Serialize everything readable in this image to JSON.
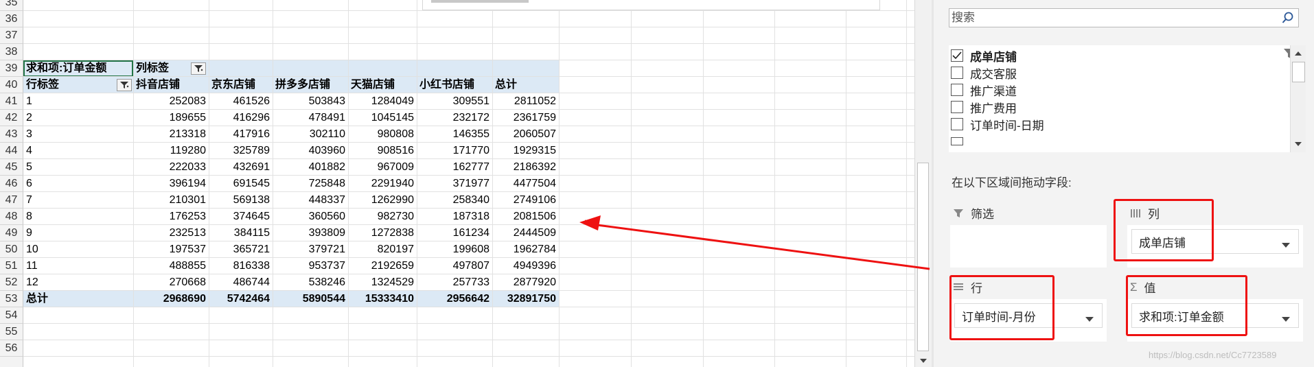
{
  "sheet": {
    "empty_rows": [
      "35",
      "36",
      "37",
      "38",
      "54",
      "55",
      "56"
    ],
    "pivot": {
      "value_title": "求和项:订单金额",
      "column_label": "列标签",
      "row_label": "行标签",
      "columns": [
        "抖音店铺",
        "京东店铺",
        "拼多多店铺",
        "天猫店铺",
        "小红书店铺",
        "总计"
      ],
      "rows": [
        {
          "rownum": "41",
          "label": "1",
          "values": [
            "252083",
            "461526",
            "503843",
            "1284049",
            "309551",
            "2811052"
          ]
        },
        {
          "rownum": "42",
          "label": "2",
          "values": [
            "189655",
            "416296",
            "478491",
            "1045145",
            "232172",
            "2361759"
          ]
        },
        {
          "rownum": "43",
          "label": "3",
          "values": [
            "213318",
            "417916",
            "302110",
            "980808",
            "146355",
            "2060507"
          ]
        },
        {
          "rownum": "44",
          "label": "4",
          "values": [
            "119280",
            "325789",
            "403960",
            "908516",
            "171770",
            "1929315"
          ]
        },
        {
          "rownum": "45",
          "label": "5",
          "values": [
            "222033",
            "432691",
            "401882",
            "967009",
            "162777",
            "2186392"
          ]
        },
        {
          "rownum": "46",
          "label": "6",
          "values": [
            "396194",
            "691545",
            "725848",
            "2291940",
            "371977",
            "4477504"
          ]
        },
        {
          "rownum": "47",
          "label": "7",
          "values": [
            "210301",
            "569138",
            "448337",
            "1262990",
            "258340",
            "2749106"
          ]
        },
        {
          "rownum": "48",
          "label": "8",
          "values": [
            "176253",
            "374645",
            "360560",
            "982730",
            "187318",
            "2081506"
          ]
        },
        {
          "rownum": "49",
          "label": "9",
          "values": [
            "232513",
            "384115",
            "393809",
            "1272838",
            "161234",
            "2444509"
          ]
        },
        {
          "rownum": "50",
          "label": "10",
          "values": [
            "197537",
            "365721",
            "379721",
            "820197",
            "199608",
            "1962784"
          ]
        },
        {
          "rownum": "51",
          "label": "11",
          "values": [
            "488855",
            "816338",
            "953737",
            "2192659",
            "497807",
            "4949396"
          ]
        },
        {
          "rownum": "52",
          "label": "12",
          "values": [
            "270668",
            "486744",
            "538246",
            "1324529",
            "257733",
            "2877920"
          ]
        }
      ],
      "total": {
        "rownum": "53",
        "label": "总计",
        "values": [
          "2968690",
          "5742464",
          "5890544",
          "15333410",
          "2956642",
          "32891750"
        ]
      },
      "header_rownums": [
        "39",
        "40"
      ]
    }
  },
  "pane": {
    "search_placeholder": "搜索",
    "fields": [
      {
        "label": "成单店铺",
        "checked": true
      },
      {
        "label": "成交客服",
        "checked": false
      },
      {
        "label": "推广渠道",
        "checked": false
      },
      {
        "label": "推广费用",
        "checked": false
      },
      {
        "label": "订单时间-日期",
        "checked": false
      }
    ],
    "drag_hint": "在以下区域间拖动字段:",
    "areas": {
      "filter": {
        "title": "筛选"
      },
      "columns": {
        "title": "列",
        "item": "成单店铺"
      },
      "rows": {
        "title": "行",
        "item": "订单时间-月份"
      },
      "values": {
        "title": "值",
        "item": "求和项:订单金额"
      }
    }
  },
  "watermark": "https://blog.csdn.net/Cc7723589",
  "colors": {
    "accent_red": "#ee1111",
    "pivot_header": "#dce9f5",
    "excel_green": "#217346"
  }
}
